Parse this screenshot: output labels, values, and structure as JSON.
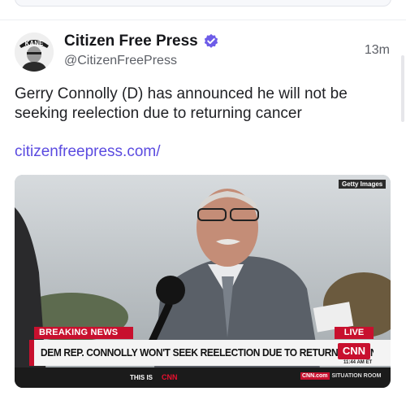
{
  "post": {
    "author": {
      "display_name": "Citizen Free Press",
      "handle": "@CitizenFreePress",
      "avatar_text": "KANE",
      "verified": true
    },
    "time_ago": "13m",
    "text": "Gerry Connolly (D) has announced he will not be seeking reelection due to returning cancer",
    "link": "citizenfreepress.com/"
  },
  "media": {
    "watermark": "Getty Images",
    "breaking_label": "BREAKING NEWS",
    "live_label": "LIVE",
    "headline": "DEM REP. CONNOLLY WON'T SEEK REELECTION DUE TO RETURNING CANCER",
    "network_logo": "CNN",
    "clock": "11:44 AM ET",
    "this_is_label": "THIS IS",
    "this_is_logo": "CNN",
    "site_logo": "CNN.com",
    "program": "SITUATION ROOM"
  },
  "colors": {
    "accent": "#5b4be0",
    "verified": "#6d5ce8",
    "cnn_red": "#c8102e"
  },
  "icons": {
    "verified": "verified-badge-icon"
  }
}
